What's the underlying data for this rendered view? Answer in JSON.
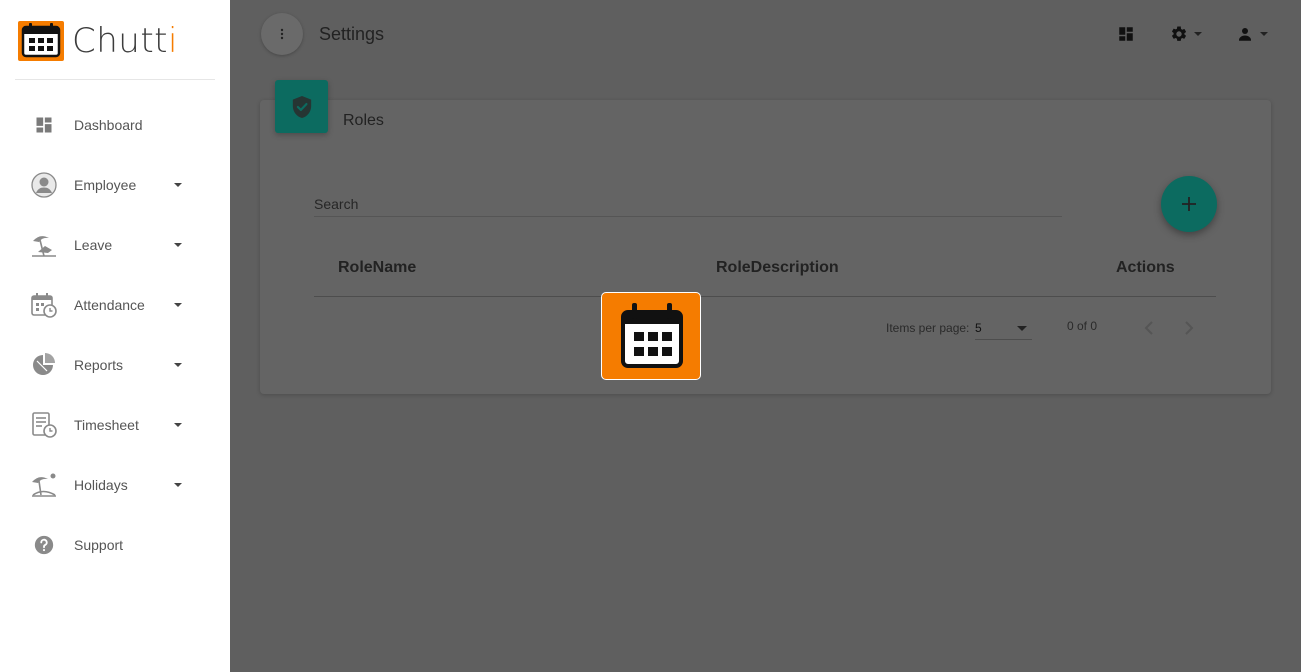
{
  "brand": {
    "name_main": "Chutt",
    "name_accent": "i",
    "accent_color": "#f57c00",
    "text_color": "#3c3c3c"
  },
  "sidebar": {
    "items": [
      {
        "label": "Dashboard",
        "icon": "dashboard-icon",
        "has_caret": false
      },
      {
        "label": "Employee",
        "icon": "person-icon",
        "has_caret": true
      },
      {
        "label": "Leave",
        "icon": "beach-icon",
        "has_caret": true
      },
      {
        "label": "Attendance",
        "icon": "calendar-clock-icon",
        "has_caret": true
      },
      {
        "label": "Reports",
        "icon": "pie-chart-icon",
        "has_caret": true
      },
      {
        "label": "Timesheet",
        "icon": "timesheet-icon",
        "has_caret": true
      },
      {
        "label": "Holidays",
        "icon": "island-icon",
        "has_caret": true
      },
      {
        "label": "Support",
        "icon": "help-icon",
        "has_caret": false
      }
    ]
  },
  "header": {
    "title": "Settings",
    "icons": [
      "dashboard-icon",
      "gear-icon",
      "user-icon"
    ]
  },
  "card": {
    "title": "Roles",
    "header_icon": "shield-check-icon",
    "accent_color": "#0c6b60",
    "search": {
      "placeholder": "Search",
      "value": ""
    },
    "add_button_icon": "plus-icon",
    "columns": [
      "RoleName",
      "RoleDescription",
      "Actions"
    ],
    "rows": [],
    "pagination": {
      "items_per_page_label": "Items per page:",
      "items_per_page": "5",
      "range": "0 of 0"
    }
  },
  "overlay": {
    "loading_icon": "calendar-icon",
    "backdrop_color": "#5f5f5f"
  }
}
